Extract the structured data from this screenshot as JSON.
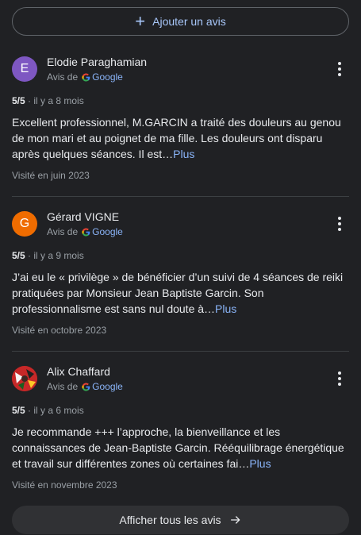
{
  "add_review": {
    "label": "Ajouter un avis",
    "icon": "plus-icon"
  },
  "reviews": [
    {
      "author": "Elodie Paraghamian",
      "initial": "E",
      "avatar_color": "#7e57c2",
      "source_prefix": "Avis de",
      "source_name": "Google",
      "rating": "5/5",
      "time": "il y a 8 mois",
      "text": "Excellent professionnel, M.GARCIN a traité des douleurs au genou de mon mari et au poignet de ma fille. Les douleurs ont disparu après quelques séances. Il est…",
      "more_label": "Plus",
      "visited": "Visité en juin 2023"
    },
    {
      "author": "Gérard VIGNE",
      "initial": "G",
      "avatar_color": "#ef6c00",
      "source_prefix": "Avis de",
      "source_name": "Google",
      "rating": "5/5",
      "time": "il y a 9 mois",
      "text": "J’ai eu le « privilège » de bénéficier d’un suivi de 4 séances de reiki pratiquées par Monsieur Jean Baptiste Garcin. Son professionnalisme est sans nul doute à…",
      "more_label": "Plus",
      "visited": "Visité en octobre 2023"
    },
    {
      "author": "Alix Chaffard",
      "initial": "",
      "avatar_color": "#b71c1c",
      "source_prefix": "Avis de",
      "source_name": "Google",
      "rating": "5/5",
      "time": "il y a 6 mois",
      "text": "Je recommande +++ l’approche, la bienveillance et les connaissances de Jean-Baptiste Garcin. Rééquilibrage énergétique et travail sur différentes zones où certaines fai…",
      "more_label": "Plus",
      "visited": "Visité en novembre 2023"
    }
  ],
  "show_all": {
    "label": "Afficher tous les avis",
    "icon": "arrow-right-icon"
  },
  "colors": {
    "background": "#202124",
    "accent": "#8ab4f8",
    "text": "#e8eaed",
    "muted": "#9aa0a6"
  }
}
